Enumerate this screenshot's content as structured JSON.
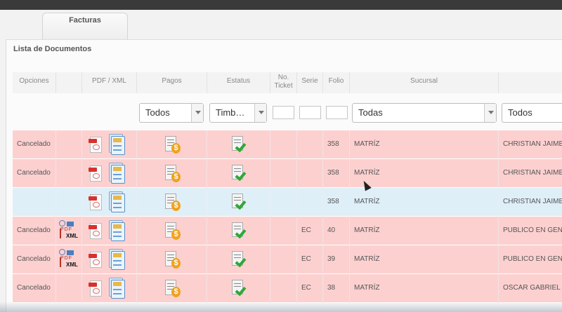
{
  "tabs": [
    {
      "label": "Facturas"
    }
  ],
  "panel": {
    "title": "Lista de Documentos"
  },
  "columns": {
    "opciones": "Opciones",
    "pdf_xml": "PDF / XML",
    "pagos": "Pagos",
    "estatus": "Estatus",
    "ticket": "No. Ticket",
    "serie": "Serie",
    "folio": "Folio",
    "sucursal": "Sucursal"
  },
  "filters": {
    "pagos": "Todos",
    "estatus": "Timb…",
    "sucursal": "Todas",
    "cliente": "Todos"
  },
  "rows": [
    {
      "status": "cancelled",
      "opcion": "Cancelado",
      "serie": "",
      "folio": "358",
      "sucursal": "MATRÍZ",
      "cliente": "CHRISTIAN JAIME",
      "mail_icon": false
    },
    {
      "status": "cancelled",
      "opcion": "Cancelado",
      "serie": "",
      "folio": "358",
      "sucursal": "MATRÍZ",
      "cliente": "CHRISTIAN JAIME",
      "mail_icon": false
    },
    {
      "status": "active",
      "opcion": "",
      "serie": "",
      "folio": "358",
      "sucursal": "MATRÍZ",
      "cliente": "CHRISTIAN JAIME",
      "mail_icon": false
    },
    {
      "status": "cancelled",
      "opcion": "Cancelado",
      "serie": "EC",
      "folio": "40",
      "sucursal": "MATRÍZ",
      "cliente": "PUBLICO EN GEN",
      "mail_icon": true
    },
    {
      "status": "cancelled",
      "opcion": "Cancelado",
      "serie": "EC",
      "folio": "39",
      "sucursal": "MATRÍZ",
      "cliente": "PUBLICO EN GEN",
      "mail_icon": true
    },
    {
      "status": "cancelled",
      "opcion": "Cancelado",
      "serie": "EC",
      "folio": "38",
      "sucursal": "MATRÍZ",
      "cliente": "OSCAR GABRIEL",
      "mail_icon": false
    }
  ],
  "icons": {
    "pdf": "pdf-file-icon",
    "xml": "xml-file-icon",
    "pagos": "payment-doc-icon",
    "estatus": "stamped-check-icon",
    "mail": "email-pdf-xml-icon"
  },
  "colors": {
    "cancelled_row": "#fdd0d0",
    "active_row": "#dfeff8",
    "check_green": "#2ea837",
    "coin_orange": "#f0a21d",
    "pdf_red": "#d9312b"
  }
}
